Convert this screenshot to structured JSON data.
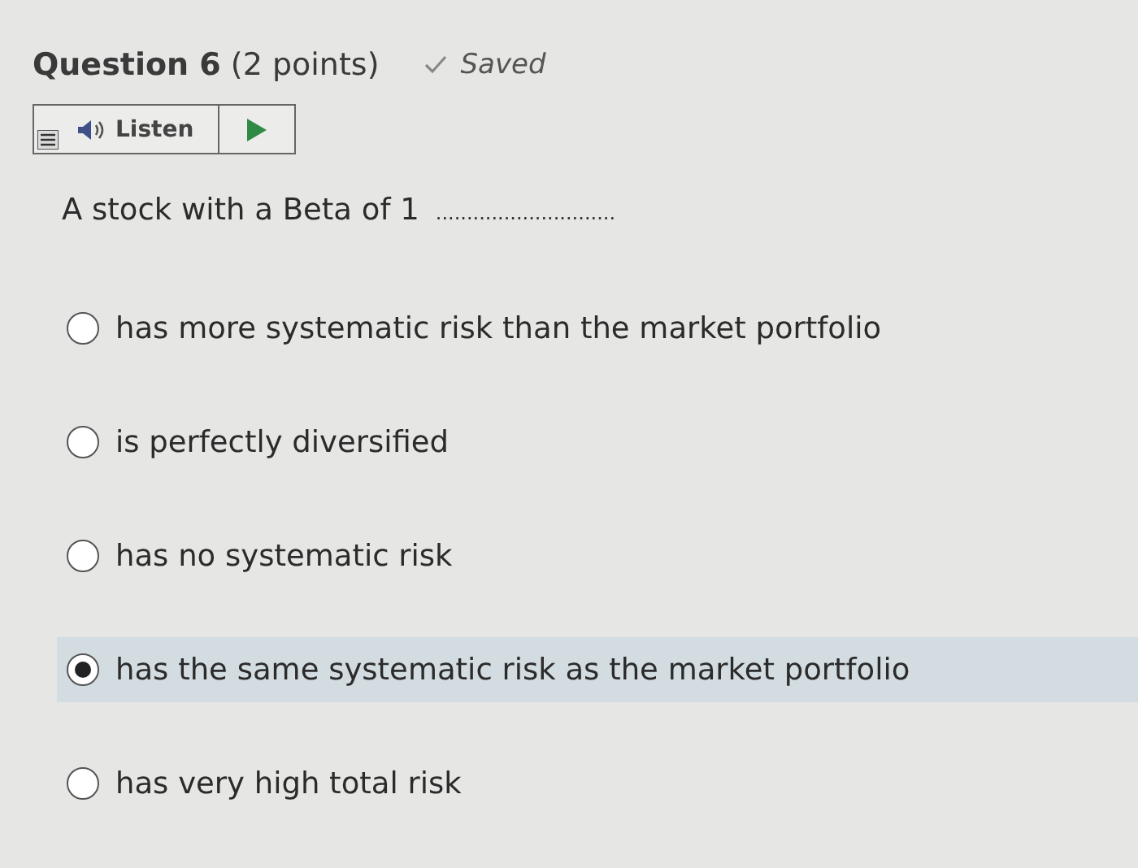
{
  "header": {
    "title": "**Question 6** (2 points)",
    "status": "Saved"
  },
  "listen_bar": {
    "label": "Listen"
  },
  "question": {
    "text": "A stock with a Beta of 1",
    "blank": "............................."
  },
  "options": [
    {
      "label": "has more systematic risk than the market portfolio",
      "selected": false
    },
    {
      "label": "is perfectly diversified",
      "selected": false
    },
    {
      "label": "has no systematic risk",
      "selected": false
    },
    {
      "label": "has the same systematic risk as the market portfolio",
      "selected": true
    },
    {
      "label": "has very high total risk",
      "selected": false
    }
  ]
}
